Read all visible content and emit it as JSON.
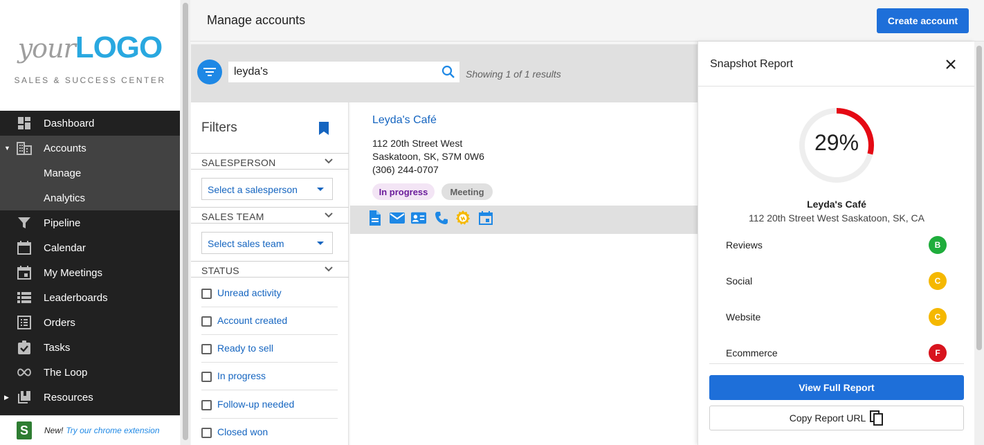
{
  "sidebar": {
    "logo_prefix": "your",
    "logo_brand": "LOGO",
    "tagline": "SALES & SUCCESS CENTER",
    "items": [
      {
        "label": "Dashboard",
        "icon": "dashboard-icon"
      },
      {
        "label": "Accounts",
        "icon": "accounts-icon"
      },
      {
        "label": "Pipeline",
        "icon": "filter-funnel-icon"
      },
      {
        "label": "Calendar",
        "icon": "calendar-icon"
      },
      {
        "label": "My Meetings",
        "icon": "meetings-icon"
      },
      {
        "label": "Leaderboards",
        "icon": "list-icon"
      },
      {
        "label": "Orders",
        "icon": "orders-icon"
      },
      {
        "label": "Tasks",
        "icon": "tasks-icon"
      },
      {
        "label": "The Loop",
        "icon": "infinity-icon"
      },
      {
        "label": "Resources",
        "icon": "resources-icon"
      }
    ],
    "accounts_sub": [
      "Manage",
      "Analytics"
    ],
    "footer_new": "New!",
    "footer_link": "Try our chrome extension"
  },
  "header": {
    "title": "Manage accounts",
    "create_label": "Create account"
  },
  "search": {
    "value": "leyda's",
    "results": "Showing 1 of 1 results"
  },
  "filters": {
    "title": "Filters",
    "salesperson_label": "SALESPERSON",
    "salesperson_placeholder": "Select a salesperson",
    "team_label": "SALES TEAM",
    "team_placeholder": "Select sales team",
    "status_label": "STATUS",
    "status_options": [
      "Unread activity",
      "Account created",
      "Ready to sell",
      "In progress",
      "Follow-up needed",
      "Closed won"
    ]
  },
  "account": {
    "name": "Leyda's Café",
    "address_line1": "112 20th Street West",
    "address_line2": "Saskatoon, SK, S7M 0W6",
    "phone": "(306) 244-0707",
    "badges": [
      "In progress",
      "Meeting"
    ]
  },
  "snapshot": {
    "title": "Snapshot Report",
    "score": 29,
    "score_label": "29%",
    "business_name": "Leyda's Café",
    "business_address": "112 20th Street West Saskatoon, SK, CA",
    "grades": [
      {
        "name": "Reviews",
        "grade": "B",
        "color": "#1fad3c"
      },
      {
        "name": "Social",
        "grade": "C",
        "color": "#f5b800"
      },
      {
        "name": "Website",
        "grade": "C",
        "color": "#f5b800"
      },
      {
        "name": "Ecommerce",
        "grade": "F",
        "color": "#d8141e"
      }
    ],
    "view_label": "View Full Report",
    "copy_label": "Copy Report URL"
  },
  "colors": {
    "accent": "#1e6fd9",
    "gauge": "#e50914"
  }
}
